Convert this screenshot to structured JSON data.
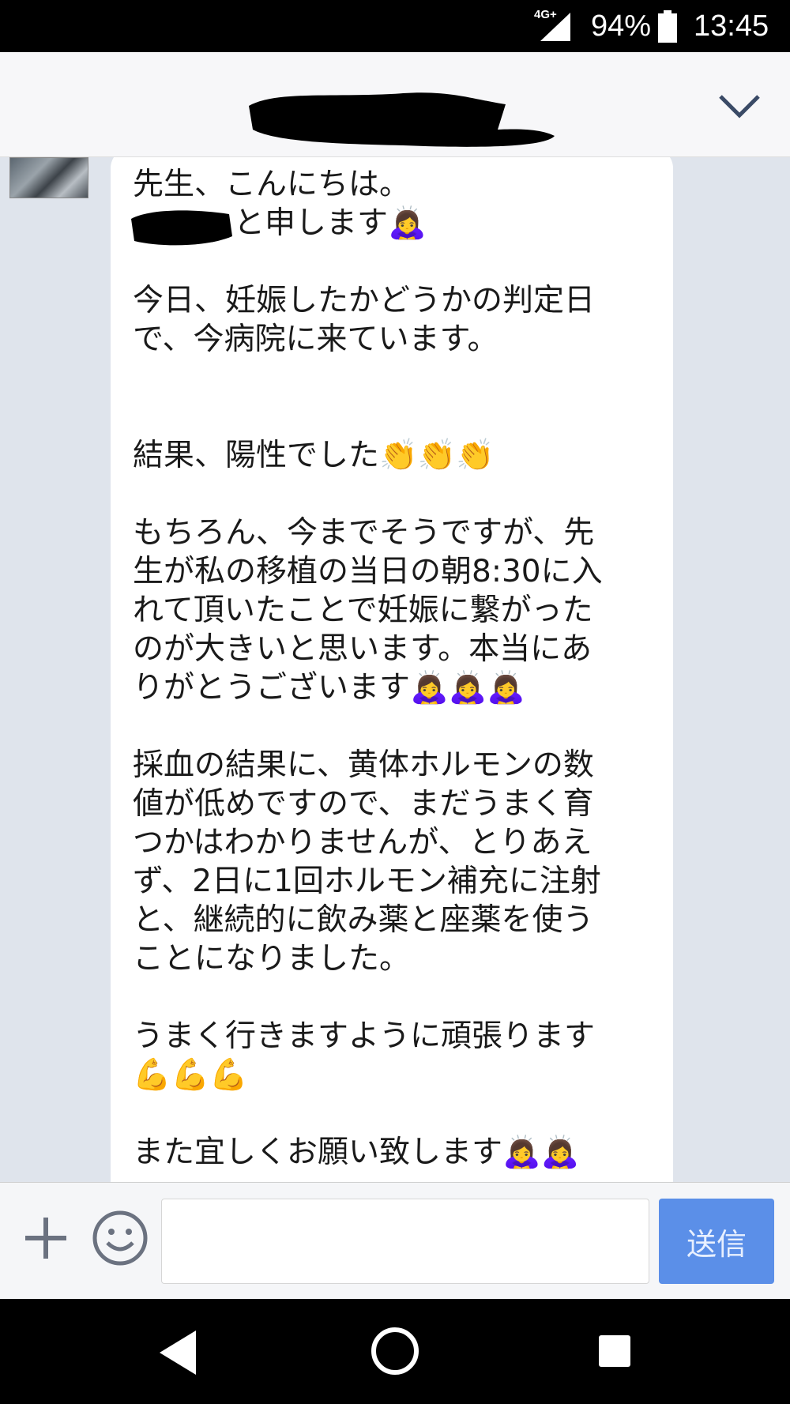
{
  "status": {
    "network": "4G+",
    "battery": "94%",
    "time": "13:45"
  },
  "header": {
    "title_redacted": true
  },
  "message": {
    "lines": [
      "先生、こんにちは。",
      "と申します",
      "",
      "今日、妊娠したかどうかの判定日",
      "で、今病院に来ています。",
      "",
      "",
      "結果、陽性でした",
      "",
      "もちろん、今までそうですが、先",
      "生が私の移植の当日の朝8:30に入",
      "れて頂いたことで妊娠に繋がった",
      "のが大きいと思います。本当にあ",
      "りがとうございます",
      "",
      "採血の結果に、黄体ホルモンの数",
      "値が低めですので、まだうまく育",
      "つかはわかりませんが、とりあえ",
      "ず、2日に1回ホルモン補充に注射",
      "と、継続的に飲み薬と座薬を使う",
      "ことになりました。",
      "",
      "うまく行きますように頑張ります",
      "",
      "",
      "また宜しくお願い致します"
    ],
    "emoji": {
      "bow": "🙇‍♀️",
      "clap": "👏",
      "muscle": "💪"
    }
  },
  "input": {
    "placeholder": "",
    "send_label": "送信"
  },
  "colors": {
    "send_button": "#5b8fe8",
    "chat_bg": "#dfe4ec"
  }
}
